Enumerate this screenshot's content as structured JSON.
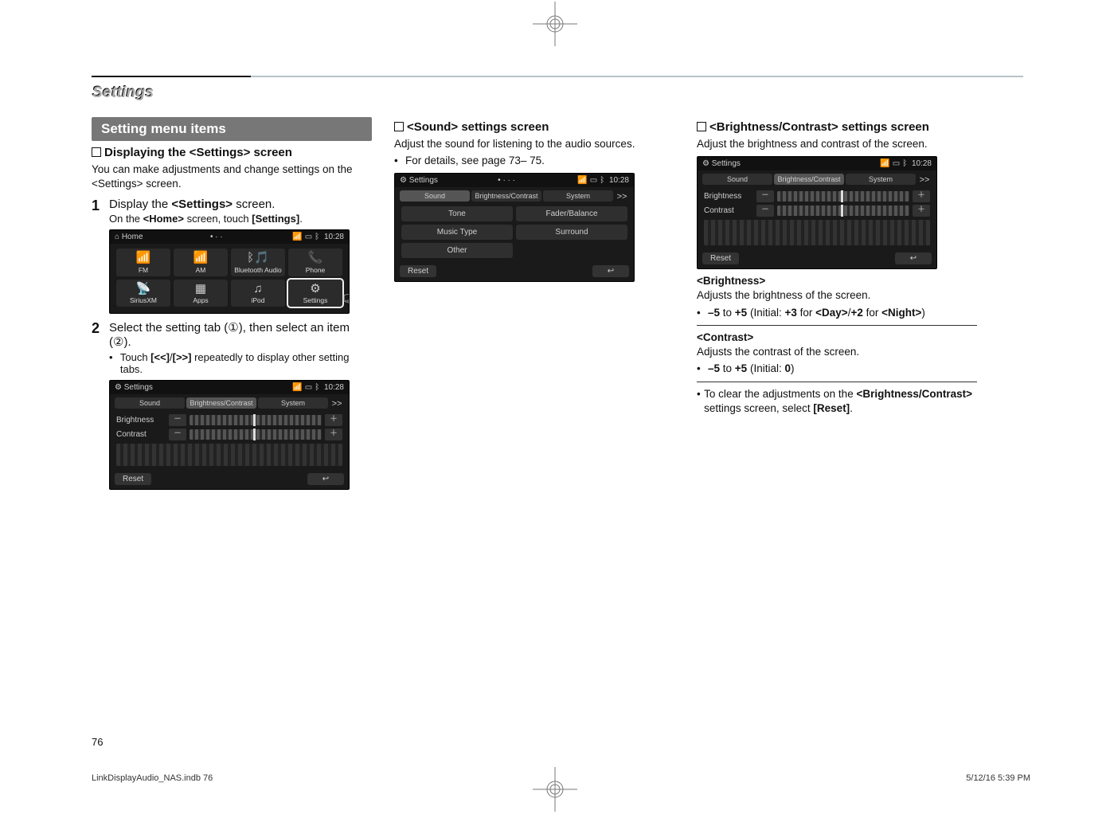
{
  "header": {
    "section": "Settings"
  },
  "col1": {
    "menubox": "Setting menu items",
    "sub1": "Displaying the <Settings> screen",
    "intro": "You can make adjustments and change settings on the <Settings> screen.",
    "step1_n": "1",
    "step1_title_pre": "Display the ",
    "step1_title_bold": "<Settings>",
    "step1_title_post": " screen.",
    "step1_sub": "On the <Home> screen, touch [Settings].",
    "home": {
      "title": "Home",
      "dots": "• · ·",
      "time": "10:28",
      "cells": [
        {
          "icon": "📶",
          "label": "FM"
        },
        {
          "icon": "📶",
          "label": "AM"
        },
        {
          "icon": "ᛒ🎵",
          "label": "Bluetooth Audio"
        },
        {
          "icon": "📞",
          "label": "Phone"
        },
        {
          "icon": "📡",
          "label": "SiriusXM"
        },
        {
          "icon": "▦",
          "label": "Apps"
        },
        {
          "icon": "♫",
          "label": "iPod"
        },
        {
          "icon": "⚙",
          "label": "Settings"
        }
      ]
    },
    "step2_n": "2",
    "step2_body": "Select the setting tab (①), then select an item (②).",
    "step2_bullet": "Touch [<<]/[>>] repeatedly to display other setting tabs.",
    "shot2": {
      "title": "Settings",
      "time": "10:28",
      "tabs": [
        "Sound",
        "Brightness/Contrast",
        "System"
      ],
      "brightness": "Brightness",
      "contrast": "Contrast",
      "reset": "Reset"
    }
  },
  "col2": {
    "h": "<Sound> settings screen",
    "p": "Adjust the sound for listening to the audio sources.",
    "bullet": "For details, see page 73– 75.",
    "shot": {
      "title": "Settings",
      "time": "10:28",
      "tabs": [
        "Sound",
        "Brightness/Contrast",
        "System"
      ],
      "btns": [
        "Tone",
        "Fader/Balance",
        "Music Type",
        "Surround",
        "Other"
      ],
      "reset": "Reset"
    }
  },
  "col3": {
    "h": "<Brightness/Contrast> settings screen",
    "p": "Adjust the brightness and contrast of the screen.",
    "shot": {
      "title": "Settings",
      "time": "10:28",
      "tabs": [
        "Sound",
        "Brightness/Contrast",
        "System"
      ],
      "brightness": "Brightness",
      "contrast": "Contrast",
      "reset": "Reset"
    },
    "b_h": "<Brightness>",
    "b_p": "Adjusts the brightness of the screen.",
    "b_bul": "–5 to +5 (Initial: +3 for <Day>/+2 for <Night>)",
    "c_h": "<Contrast>",
    "c_p": "Adjusts the contrast of the screen.",
    "c_bul": "–5 to +5 (Initial: 0)",
    "clr": "To clear the adjustments on the <Brightness/Contrast> settings screen, select [Reset]."
  },
  "footer": {
    "page": "76",
    "file": "LinkDisplayAudio_NAS.indb   76",
    "date": "5/12/16   5:39 PM"
  },
  "glyphs": {
    "signal": "📶",
    "batt": "▭",
    "bt": "ᛒ",
    "house": "⌂",
    "back": "↩",
    "plus": "＋",
    "minus": "－",
    "chev": ">>",
    "hand": "☟"
  }
}
